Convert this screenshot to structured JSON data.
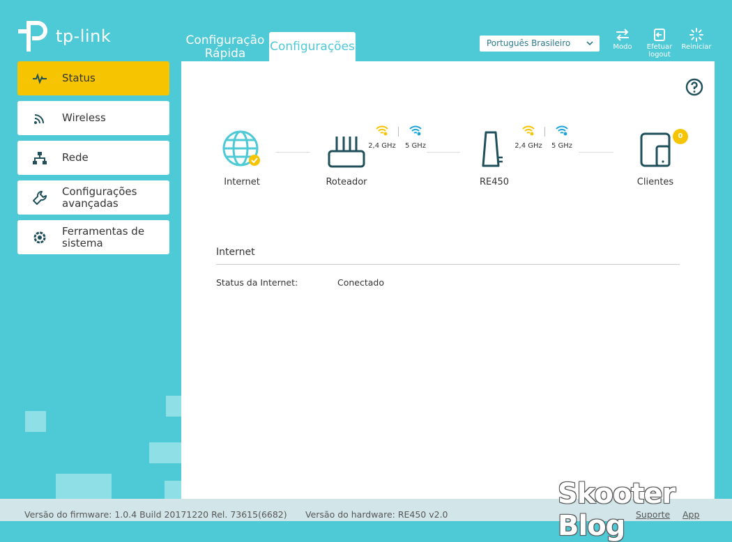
{
  "brand": {
    "name": "tp-link"
  },
  "top_tabs": [
    {
      "label_line1": "Configuração",
      "label_line2": "Rápida"
    },
    {
      "label": "Configurações"
    }
  ],
  "language": {
    "selected": "Português Brasileiro"
  },
  "tools": [
    {
      "label": "Modo",
      "icon": "mode-switch-icon"
    },
    {
      "label_line1": "Efetuar",
      "label_line2": "logout",
      "icon": "logout-icon"
    },
    {
      "label": "Reiniciar",
      "icon": "reboot-icon"
    }
  ],
  "sidebar": {
    "items": [
      {
        "label": "Status",
        "icon": "pulse-icon",
        "active": true
      },
      {
        "label": "Wireless",
        "icon": "wireless-icon"
      },
      {
        "label": "Rede",
        "icon": "network-icon"
      },
      {
        "label_line1": "Configurações",
        "label_line2": "avançadas",
        "icon": "wrench-icon"
      },
      {
        "label_line1": "Ferramentas de",
        "label_line2": "sistema",
        "icon": "gear-icon"
      }
    ]
  },
  "topology": {
    "internet": {
      "label": "Internet"
    },
    "router": {
      "label": "Roteador",
      "band_24": "2,4 GHz",
      "band_5": "5 GHz"
    },
    "extender": {
      "label": "RE450",
      "band_24": "2,4 GHz",
      "band_5": "5 GHz"
    },
    "clients": {
      "label": "Clientes",
      "count": "0"
    }
  },
  "section": {
    "title": "Internet",
    "status_label": "Status da Internet:",
    "status_value": "Conectado"
  },
  "footer": {
    "firmware": "Versão do firmware: 1.0.4 Build 20171220 Rel. 73615(6682)",
    "hardware": "Versão do hardware: RE450 v2.0",
    "support": "Suporte",
    "app": "App"
  },
  "watermark": "Skooter Blog",
  "colors": {
    "accent": "#4ec9d6",
    "active": "#f6c400",
    "icon": "#1e4f5a",
    "wifi_24": "#f6c400",
    "wifi_5": "#1aa3d9"
  }
}
